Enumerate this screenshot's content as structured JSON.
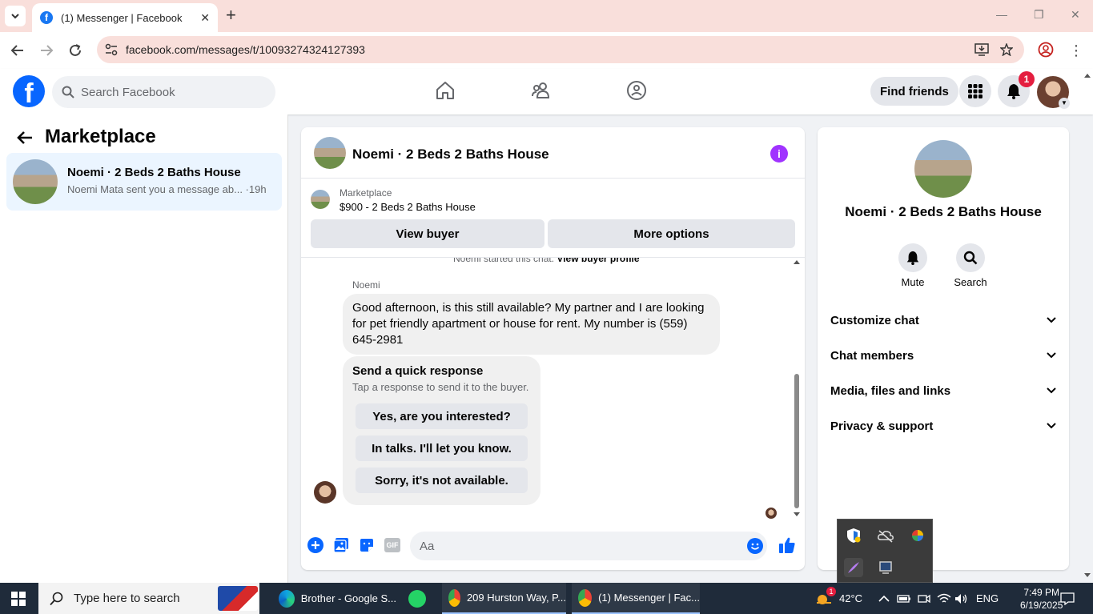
{
  "browser": {
    "tab_title": "(1) Messenger | Facebook",
    "url": "facebook.com/messages/t/10093274324127393",
    "favicon_letter": "f"
  },
  "fb": {
    "search_placeholder": "Search Facebook",
    "find_friends": "Find friends",
    "notifications_count": "1"
  },
  "inbox": {
    "heading": "Marketplace",
    "conversations": [
      {
        "name": "Noemi · 2 Beds 2 Baths House",
        "snippet": "Noemi Mata sent you a message ab... ·19h"
      }
    ]
  },
  "chat": {
    "title": "Noemi · 2 Beds 2 Baths House",
    "marketplace_label": "Marketplace",
    "listing": "$900 - 2 Beds 2 Baths House",
    "view_buyer": "View buyer",
    "more_options": "More options",
    "started_text": "Noemi started this chat.",
    "started_link": "View buyer profile",
    "sender_name": "Noemi",
    "message": "Good afternoon, is this still available? My partner and I are looking for pet friendly apartment or house for rent. My number is (559) 645-2981",
    "quick_title": "Send a quick response",
    "quick_subtitle": "Tap a response to send it to the buyer.",
    "quick_responses": [
      "Yes, are you interested?",
      "In talks. I'll let you know.",
      "Sorry, it's not available."
    ],
    "input_placeholder": "Aa",
    "gif_label": "GIF"
  },
  "details": {
    "title": "Noemi · 2 Beds 2 Baths House",
    "mute": "Mute",
    "search": "Search",
    "sections": [
      "Customize chat",
      "Chat members",
      "Media, files and links",
      "Privacy & support"
    ]
  },
  "taskbar": {
    "search_placeholder": "Type here to search",
    "apps": [
      "Brother - Google S...",
      "209 Hurston Way, P...",
      "(1) Messenger | Fac..."
    ],
    "temperature": "42°C",
    "weather_badge": "1",
    "language": "ENG",
    "time": "7:49 PM",
    "date": "6/19/2025"
  },
  "colors": {
    "fb_blue": "#0866ff",
    "tab_strip": "#f9dfdb",
    "info_purple": "#a033ff",
    "badge_red": "#e41e3f"
  }
}
